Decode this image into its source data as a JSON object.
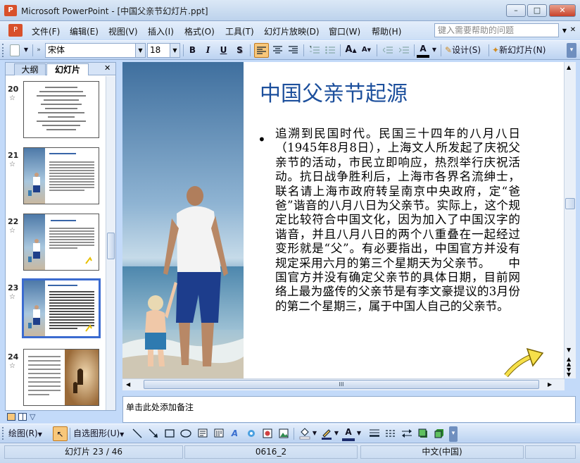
{
  "window": {
    "title": "Microsoft PowerPoint - [中国父亲节幻灯片.ppt]",
    "min_glyph": "–",
    "max_glyph": "□",
    "close_glyph": "✕"
  },
  "menu": {
    "items": [
      "文件(F)",
      "编辑(E)",
      "视图(V)",
      "插入(I)",
      "格式(O)",
      "工具(T)",
      "幻灯片放映(D)",
      "窗口(W)",
      "帮助(H)"
    ],
    "help_placeholder": "键入需要帮助的问题",
    "close_doc": "✕"
  },
  "toolbar": {
    "font": "宋体",
    "size": "18",
    "bold": "B",
    "italic": "I",
    "underline": "U",
    "shadow": "S",
    "design_label": "设计(S)",
    "new_slide_label": "新幻灯片(N)",
    "grow": "A",
    "shrink": "A",
    "font_color": "A"
  },
  "panes": {
    "outline_tab": "大纲",
    "slides_tab": "幻灯片",
    "close": "✕"
  },
  "thumbnails": [
    {
      "number": "20",
      "star": "☆"
    },
    {
      "number": "21",
      "star": "☆",
      "title": "父亲节的由来"
    },
    {
      "number": "22",
      "star": "☆",
      "title": "父亲节的由来"
    },
    {
      "number": "23",
      "star": "☆",
      "title": "中国父亲节起源"
    },
    {
      "number": "24",
      "star": "☆"
    }
  ],
  "slide": {
    "title": "中国父亲节起源",
    "bullet": "•",
    "body": "追溯到民国时代。民国三十四年的八月八日（1945年8月8日），上海文人所发起了庆祝父亲节的活动，市民立即响应，热烈举行庆祝活动。抗日战争胜利后，上海市各界名流绅士，联名请上海市政府转呈南京中央政府，定“爸爸”谐音的八月八日为父亲节。实际上，这个规定比较符合中国文化，因为加入了中国汉字的谐音，并且八月八日的两个八重叠在一起经过变形就是“父”。有必要指出，中国官方并没有规定采用六月的第三个星期天为父亲节。　　中国官方并没有确定父亲节的具体日期，目前网络上最为盛传的父亲节是有李文豪提议的3月份的第二个星期三，属于中国人自己的父亲节。"
  },
  "notes": {
    "placeholder": "单击此处添加备注"
  },
  "drawbar": {
    "draw_label": "绘图(R)",
    "autoshapes_label": "自选图形(U)"
  },
  "status": {
    "slide_info": "幻灯片 23 / 46",
    "design": "0616_2",
    "language": "中文(中国)"
  },
  "scroll": {
    "hscroll_grip": "III"
  }
}
